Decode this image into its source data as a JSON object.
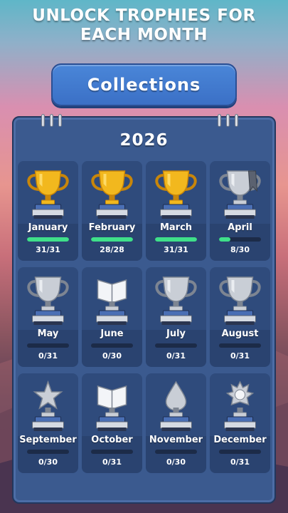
{
  "header": {
    "title_line1": "UNLOCK TROPHIES FOR",
    "title_line2": "EACH MONTH"
  },
  "collections_button": {
    "label": "Collections"
  },
  "year": "2026",
  "colors": {
    "gold": "#f2b81e",
    "silver": "#c9ced6",
    "progress": "#3fe08a",
    "button": "#3b70c6",
    "panel": "#3b5a8f"
  },
  "months": [
    {
      "name": "January",
      "count": "31/31",
      "progress": 1.0,
      "state": "gold",
      "icon": "cup-trophy-icon"
    },
    {
      "name": "February",
      "count": "28/28",
      "progress": 1.0,
      "state": "gold",
      "icon": "cup-trophy-icon"
    },
    {
      "name": "March",
      "count": "31/31",
      "progress": 1.0,
      "state": "gold",
      "icon": "cup-trophy-icon"
    },
    {
      "name": "April",
      "count": "8/30",
      "progress": 0.267,
      "state": "partial",
      "icon": "ribbon-cup-trophy-icon"
    },
    {
      "name": "May",
      "count": "0/31",
      "progress": 0,
      "state": "silver",
      "icon": "cup-trophy-icon"
    },
    {
      "name": "June",
      "count": "0/30",
      "progress": 0,
      "state": "silver",
      "icon": "book-trophy-icon"
    },
    {
      "name": "July",
      "count": "0/31",
      "progress": 0,
      "state": "silver",
      "icon": "cup-trophy-icon"
    },
    {
      "name": "August",
      "count": "0/31",
      "progress": 0,
      "state": "silver",
      "icon": "cup-trophy-icon"
    },
    {
      "name": "September",
      "count": "0/30",
      "progress": 0,
      "state": "silver",
      "icon": "star-trophy-icon"
    },
    {
      "name": "October",
      "count": "0/31",
      "progress": 0,
      "state": "silver",
      "icon": "open-book-trophy-icon"
    },
    {
      "name": "November",
      "count": "0/30",
      "progress": 0,
      "state": "silver",
      "icon": "drop-trophy-icon"
    },
    {
      "name": "December",
      "count": "0/31",
      "progress": 0,
      "state": "silver",
      "icon": "crown-trophy-icon"
    }
  ]
}
